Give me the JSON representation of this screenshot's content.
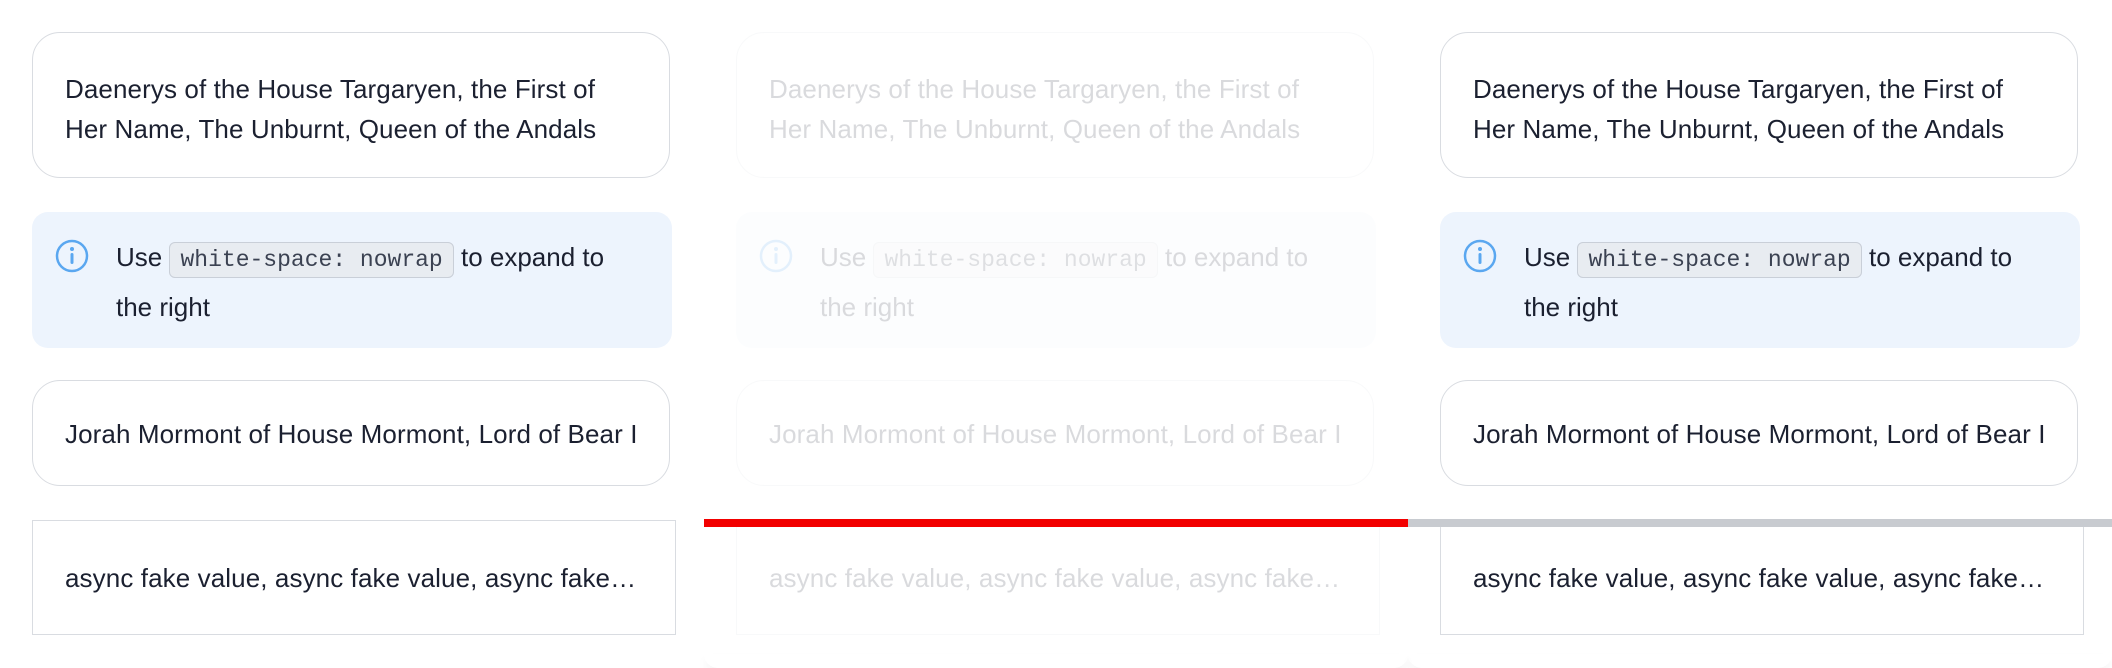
{
  "long_name": "Daenerys of the House Targaryen, the First of Her Name, The Unburnt, Queen of the Andals",
  "hint": {
    "prefix": "Use",
    "code": "white-space: nowrap",
    "suffix": "to expand to the right"
  },
  "single_line": "Jorah Mormont of House Mormont, Lord of Bear Island",
  "async_value": "async fake value, async fake value, async fake value",
  "progress": {
    "fraction": 0.5,
    "fill_color": "#f20000",
    "track_color": "#c8cbd0"
  },
  "icons": {
    "info": "info-circle-icon"
  },
  "colors": {
    "info_bg": "#edf4fd",
    "info_icon": "#5aa7f0",
    "text": "#1b2030",
    "border": "#d9dce1"
  }
}
